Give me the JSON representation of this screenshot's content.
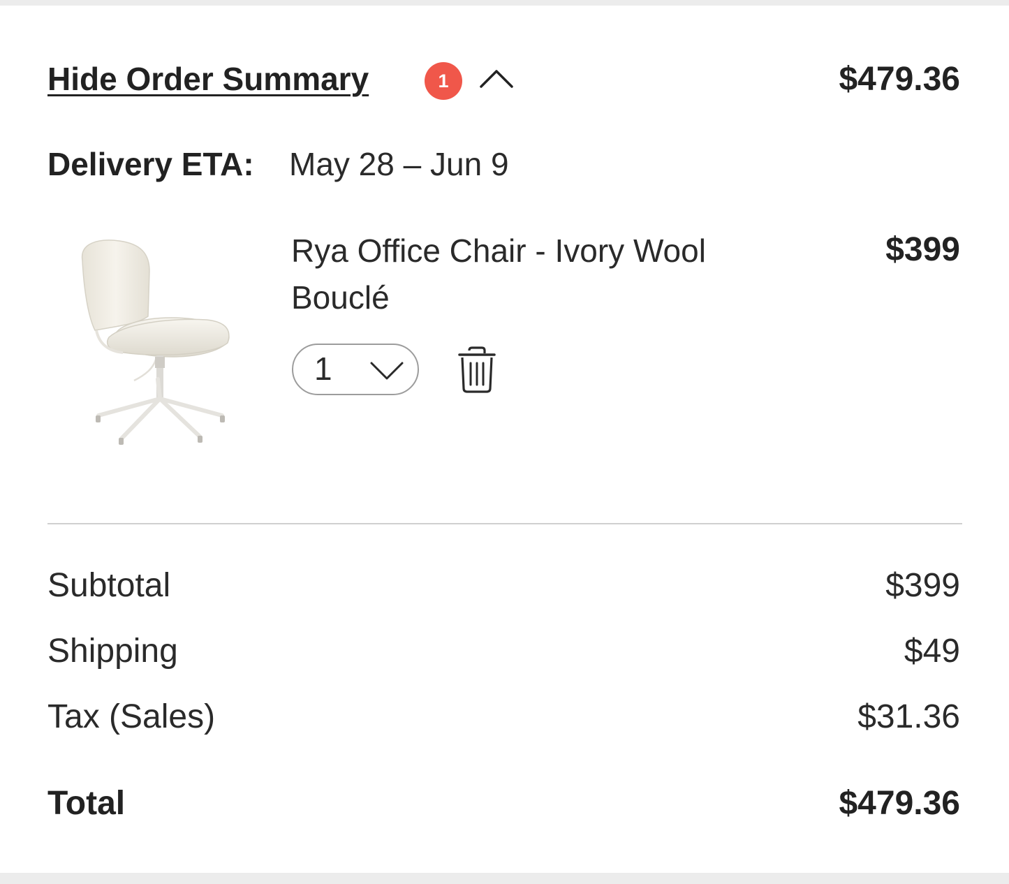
{
  "summary": {
    "toggle_label": "Hide Order Summary",
    "item_count_badge": "1",
    "badge_color": "#f0574a",
    "toggle_icon": "chevron-up-icon",
    "header_total": "$479.36"
  },
  "delivery": {
    "label": "Delivery ETA:",
    "value": "May 28 – Jun 9"
  },
  "cart_items": [
    {
      "name": "Rya Office Chair - Ivory Wool Bouclé",
      "price": "$399",
      "quantity": "1",
      "image": "office-chair-image",
      "remove_icon": "trash-icon"
    }
  ],
  "totals": {
    "subtotal_label": "Subtotal",
    "subtotal_value": "$399",
    "shipping_label": "Shipping",
    "shipping_value": "$49",
    "tax_label": "Tax (Sales)",
    "tax_value": "$31.36",
    "total_label": "Total",
    "total_value": "$479.36"
  }
}
